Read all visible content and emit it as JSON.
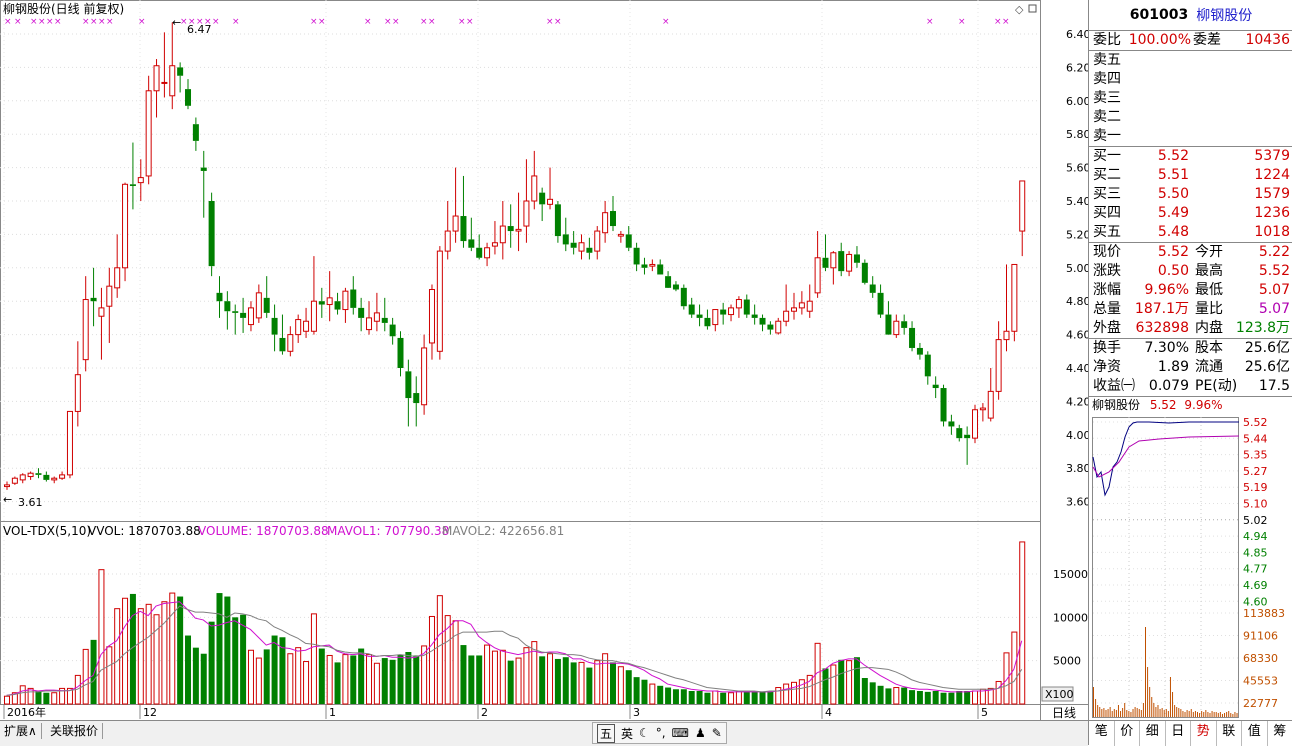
{
  "chart": {
    "title": "柳钢股份(日线 前复权)",
    "price_axis": [
      "6.40",
      "6.20",
      "6.00",
      "5.80",
      "5.60",
      "5.40",
      "5.20",
      "5.00",
      "4.80",
      "4.60",
      "4.40",
      "4.20",
      "4.00",
      "3.80",
      "3.60"
    ],
    "high_label": "6.47",
    "low_label": "3.61",
    "vol_header": {
      "name": "VOL-TDX(5,10)",
      "vvol": "VVOL: 1870703.88",
      "volume": "VOLUME: 1870703.88",
      "mavol1": "MAVOL1: 707790.38",
      "mavol2": "MAVOL2: 422656.81"
    },
    "vol_axis": [
      "15000",
      "10000",
      "5000"
    ],
    "vol_unit": "X100",
    "time_labels": [
      "2016年",
      "12",
      "1",
      "2",
      "3",
      "4",
      "5"
    ],
    "period_label": "日线",
    "colors": {
      "up": "#d00000",
      "down": "#008000",
      "ma1": "#d010d0",
      "ma2": "#808080"
    }
  },
  "quote": {
    "code": "601003",
    "name": "柳钢股份",
    "weibi_label": "委比",
    "weibi": "100.00%",
    "weicha_label": "委差",
    "weicha": "10436",
    "sells": [
      {
        "label": "卖五",
        "price": "",
        "vol": ""
      },
      {
        "label": "卖四",
        "price": "",
        "vol": ""
      },
      {
        "label": "卖三",
        "price": "",
        "vol": ""
      },
      {
        "label": "卖二",
        "price": "",
        "vol": ""
      },
      {
        "label": "卖一",
        "price": "",
        "vol": ""
      }
    ],
    "buys": [
      {
        "label": "买一",
        "price": "5.52",
        "vol": "5379"
      },
      {
        "label": "买二",
        "price": "5.51",
        "vol": "1224"
      },
      {
        "label": "买三",
        "price": "5.50",
        "vol": "1579"
      },
      {
        "label": "买四",
        "price": "5.49",
        "vol": "1236"
      },
      {
        "label": "买五",
        "price": "5.48",
        "vol": "1018"
      }
    ],
    "stats": [
      {
        "l1": "现价",
        "v1": "5.52",
        "c1": "red",
        "l2": "今开",
        "v2": "5.22",
        "c2": "red"
      },
      {
        "l1": "涨跌",
        "v1": "0.50",
        "c1": "red",
        "l2": "最高",
        "v2": "5.52",
        "c2": "red"
      },
      {
        "l1": "涨幅",
        "v1": "9.96%",
        "c1": "red",
        "l2": "最低",
        "v2": "5.07",
        "c2": "red"
      },
      {
        "l1": "总量",
        "v1": "187.1万",
        "c1": "dark-red",
        "l2": "量比",
        "v2": "5.07",
        "c2": "mag"
      },
      {
        "l1": "外盘",
        "v1": "632898",
        "c1": "red",
        "l2": "内盘",
        "v2": "123.8万",
        "c2": "green"
      }
    ],
    "stats2": [
      {
        "l1": "换手",
        "v1": "7.30%",
        "l2": "股本",
        "v2": "25.6亿"
      },
      {
        "l1": "净资",
        "v1": "1.89",
        "l2": "流通",
        "v2": "25.6亿"
      },
      {
        "l1": "收益㈠",
        "v1": "0.079",
        "l2": "PE(动)",
        "v2": "17.5"
      }
    ],
    "minute_header": {
      "name": "柳钢股份",
      "price": "5.52",
      "pct": "9.96%"
    },
    "minute_price_axis": [
      "5.52",
      "5.44",
      "5.35",
      "5.27",
      "5.19",
      "5.10",
      "5.02",
      "4.94",
      "4.85",
      "4.77",
      "4.69",
      "4.60"
    ],
    "minute_vol_axis": [
      "113883",
      "91106",
      "68330",
      "45553",
      "22777"
    ]
  },
  "bottom_tabs_left": [
    "扩展∧",
    "关联报价"
  ],
  "ime_bar": [
    "五",
    "英"
  ],
  "right_tabs": [
    {
      "label": "笔",
      "active": false
    },
    {
      "label": "价",
      "active": false
    },
    {
      "label": "细",
      "active": false
    },
    {
      "label": "日",
      "active": false
    },
    {
      "label": "势",
      "active": true
    },
    {
      "label": "联",
      "active": false
    },
    {
      "label": "值",
      "active": false
    },
    {
      "label": "筹",
      "active": false
    }
  ],
  "candles": [
    [
      3.69,
      3.72,
      3.67,
      3.7
    ],
    [
      3.71,
      3.75,
      3.7,
      3.74
    ],
    [
      3.73,
      3.77,
      3.71,
      3.76
    ],
    [
      3.75,
      3.78,
      3.73,
      3.77
    ],
    [
      3.77,
      3.8,
      3.74,
      3.76
    ],
    [
      3.76,
      3.78,
      3.72,
      3.73
    ],
    [
      3.73,
      3.75,
      3.71,
      3.74
    ],
    [
      3.74,
      3.78,
      3.73,
      3.76
    ],
    [
      3.76,
      4.14,
      3.74,
      4.14
    ],
    [
      4.14,
      4.56,
      4.05,
      4.36
    ],
    [
      4.45,
      4.95,
      4.38,
      4.81
    ],
    [
      4.82,
      5.0,
      4.65,
      4.8
    ],
    [
      4.71,
      4.88,
      4.45,
      4.76
    ],
    [
      4.77,
      5.0,
      4.55,
      4.89
    ],
    [
      4.88,
      5.2,
      4.82,
      5.0
    ],
    [
      5.0,
      5.51,
      4.92,
      5.5
    ],
    [
      5.5,
      5.75,
      5.35,
      5.49
    ],
    [
      5.51,
      5.65,
      5.4,
      5.54
    ],
    [
      5.55,
      6.15,
      5.5,
      6.06
    ],
    [
      6.06,
      6.25,
      5.9,
      6.21
    ],
    [
      6.11,
      6.41,
      6.02,
      6.11
    ],
    [
      6.03,
      6.47,
      5.95,
      6.21
    ],
    [
      6.2,
      6.23,
      6.05,
      6.15
    ],
    [
      6.07,
      6.13,
      5.95,
      5.97
    ],
    [
      5.86,
      5.9,
      5.7,
      5.76
    ],
    [
      5.6,
      5.7,
      5.3,
      5.58
    ],
    [
      5.4,
      5.45,
      4.95,
      5.01
    ],
    [
      4.85,
      4.95,
      4.7,
      4.8
    ],
    [
      4.8,
      4.86,
      4.63,
      4.74
    ],
    [
      4.74,
      4.78,
      4.6,
      4.73
    ],
    [
      4.73,
      4.82,
      4.61,
      4.7
    ],
    [
      4.66,
      4.8,
      4.62,
      4.76
    ],
    [
      4.7,
      4.9,
      4.67,
      4.85
    ],
    [
      4.82,
      4.95,
      4.7,
      4.73
    ],
    [
      4.7,
      4.78,
      4.5,
      4.6
    ],
    [
      4.58,
      4.72,
      4.48,
      4.5
    ],
    [
      4.5,
      4.65,
      4.47,
      4.6
    ],
    [
      4.6,
      4.72,
      4.55,
      4.69
    ],
    [
      4.62,
      4.76,
      4.58,
      4.68
    ],
    [
      4.62,
      5.07,
      4.6,
      4.8
    ],
    [
      4.8,
      4.88,
      4.7,
      4.78
    ],
    [
      4.78,
      4.98,
      4.68,
      4.82
    ],
    [
      4.8,
      4.85,
      4.72,
      4.75
    ],
    [
      4.75,
      4.88,
      4.67,
      4.86
    ],
    [
      4.87,
      4.95,
      4.72,
      4.76
    ],
    [
      4.76,
      4.82,
      4.62,
      4.7
    ],
    [
      4.63,
      4.8,
      4.6,
      4.7
    ],
    [
      4.68,
      4.85,
      4.62,
      4.73
    ],
    [
      4.7,
      4.82,
      4.62,
      4.67
    ],
    [
      4.66,
      4.7,
      4.54,
      4.59
    ],
    [
      4.58,
      4.62,
      4.35,
      4.4
    ],
    [
      4.38,
      4.45,
      4.05,
      4.22
    ],
    [
      4.25,
      4.35,
      4.05,
      4.19
    ],
    [
      4.18,
      4.6,
      4.12,
      4.52
    ],
    [
      4.55,
      4.9,
      4.45,
      4.87
    ],
    [
      4.5,
      5.13,
      4.45,
      5.1
    ],
    [
      5.1,
      5.4,
      5.05,
      5.22
    ],
    [
      5.22,
      5.6,
      5.15,
      5.31
    ],
    [
      5.31,
      5.55,
      5.12,
      5.16
    ],
    [
      5.17,
      5.3,
      5.1,
      5.12
    ],
    [
      5.12,
      5.2,
      5.05,
      5.06
    ],
    [
      5.06,
      5.15,
      5.01,
      5.12
    ],
    [
      5.13,
      5.28,
      5.08,
      5.15
    ],
    [
      5.15,
      5.4,
      5.05,
      5.25
    ],
    [
      5.25,
      5.38,
      5.12,
      5.22
    ],
    [
      5.22,
      5.45,
      5.1,
      5.23
    ],
    [
      5.25,
      5.65,
      5.15,
      5.4
    ],
    [
      5.4,
      5.7,
      5.35,
      5.55
    ],
    [
      5.45,
      5.48,
      5.28,
      5.38
    ],
    [
      5.38,
      5.6,
      5.35,
      5.41
    ],
    [
      5.38,
      5.4,
      5.15,
      5.19
    ],
    [
      5.2,
      5.3,
      5.1,
      5.14
    ],
    [
      5.15,
      5.22,
      5.08,
      5.12
    ],
    [
      5.1,
      5.2,
      5.05,
      5.15
    ],
    [
      5.12,
      5.18,
      5.05,
      5.09
    ],
    [
      5.1,
      5.25,
      5.05,
      5.22
    ],
    [
      5.21,
      5.4,
      5.15,
      5.33
    ],
    [
      5.34,
      5.43,
      5.22,
      5.25
    ],
    [
      5.19,
      5.22,
      5.15,
      5.2
    ],
    [
      5.2,
      5.25,
      5.1,
      5.12
    ],
    [
      5.12,
      5.15,
      4.98,
      5.02
    ],
    [
      5.02,
      5.06,
      4.96,
      5.0
    ],
    [
      5.01,
      5.05,
      4.98,
      5.02
    ],
    [
      5.02,
      5.05,
      4.98,
      4.96
    ],
    [
      4.95,
      4.98,
      4.9,
      4.88
    ],
    [
      4.9,
      4.92,
      4.86,
      4.87
    ],
    [
      4.88,
      4.9,
      4.75,
      4.77
    ],
    [
      4.78,
      4.82,
      4.7,
      4.72
    ],
    [
      4.72,
      4.78,
      4.65,
      4.7
    ],
    [
      4.7,
      4.75,
      4.63,
      4.65
    ],
    [
      4.66,
      4.72,
      4.62,
      4.75
    ],
    [
      4.75,
      4.79,
      4.66,
      4.72
    ],
    [
      4.72,
      4.78,
      4.68,
      4.76
    ],
    [
      4.76,
      4.83,
      4.7,
      4.81
    ],
    [
      4.81,
      4.84,
      4.7,
      4.72
    ],
    [
      4.72,
      4.78,
      4.66,
      4.7
    ],
    [
      4.7,
      4.72,
      4.62,
      4.66
    ],
    [
      4.66,
      4.68,
      4.6,
      4.63
    ],
    [
      4.61,
      4.7,
      4.6,
      4.68
    ],
    [
      4.68,
      4.9,
      4.65,
      4.74
    ],
    [
      4.74,
      4.85,
      4.69,
      4.76
    ],
    [
      4.76,
      4.86,
      4.72,
      4.79
    ],
    [
      4.74,
      4.9,
      4.7,
      4.8
    ],
    [
      4.85,
      5.22,
      4.82,
      5.06
    ],
    [
      5.06,
      5.2,
      4.98,
      5.0
    ],
    [
      5.0,
      5.1,
      4.9,
      5.09
    ],
    [
      5.1,
      5.15,
      4.95,
      4.98
    ],
    [
      4.98,
      5.1,
      4.95,
      5.08
    ],
    [
      5.08,
      5.13,
      5.0,
      5.03
    ],
    [
      5.03,
      5.05,
      4.9,
      4.91
    ],
    [
      4.9,
      4.95,
      4.82,
      4.85
    ],
    [
      4.85,
      4.9,
      4.7,
      4.72
    ],
    [
      4.72,
      4.8,
      4.65,
      4.6
    ],
    [
      4.6,
      4.72,
      4.58,
      4.68
    ],
    [
      4.68,
      4.72,
      4.6,
      4.64
    ],
    [
      4.64,
      4.68,
      4.5,
      4.52
    ],
    [
      4.52,
      4.55,
      4.45,
      4.48
    ],
    [
      4.48,
      4.5,
      4.3,
      4.35
    ],
    [
      4.3,
      4.35,
      4.22,
      4.28
    ],
    [
      4.28,
      4.3,
      4.05,
      4.08
    ],
    [
      4.08,
      4.12,
      4.0,
      4.05
    ],
    [
      4.04,
      4.06,
      3.96,
      3.98
    ],
    [
      4.0,
      4.05,
      3.82,
      3.98
    ],
    [
      3.98,
      4.18,
      3.95,
      4.15
    ],
    [
      4.15,
      4.19,
      4.08,
      4.16
    ],
    [
      4.1,
      4.4,
      4.08,
      4.26
    ],
    [
      4.26,
      4.68,
      4.21,
      4.57
    ],
    [
      4.57,
      5.02,
      4.5,
      4.62
    ],
    [
      4.62,
      5.02,
      4.56,
      5.02
    ],
    [
      5.22,
      5.52,
      5.07,
      5.52
    ]
  ],
  "volumes": [
    900,
    1300,
    2100,
    1800,
    1500,
    1300,
    1300,
    1800,
    1800,
    3300,
    6300,
    7400,
    15500,
    6600,
    11000,
    12200,
    12700,
    11000,
    11500,
    10300,
    11800,
    12800,
    12400,
    7900,
    6500,
    5800,
    9500,
    12800,
    12400,
    10000,
    10300,
    6200,
    5300,
    6300,
    7900,
    7700,
    5800,
    6500,
    4900,
    10400,
    6400,
    5600,
    4800,
    5700,
    5600,
    6400,
    5700,
    4700,
    5300,
    5100,
    5700,
    6000,
    5600,
    6700,
    10100,
    12500,
    10200,
    9600,
    6800,
    5600,
    5600,
    6800,
    6100,
    6200,
    5000,
    5300,
    6500,
    7200,
    5500,
    5800,
    5200,
    5400,
    4800,
    4800,
    4200,
    5000,
    5800,
    4800,
    4300,
    3900,
    3100,
    2800,
    2300,
    2100,
    1900,
    1700,
    1700,
    1500,
    1500,
    1300,
    1500,
    1300,
    1300,
    1500,
    1400,
    1500,
    1400,
    1400,
    1900,
    2300,
    2500,
    2800,
    3300,
    7000,
    4100,
    4500,
    5100,
    5000,
    5400,
    3000,
    2500,
    2100,
    1800,
    1900,
    1900,
    1600,
    1500,
    1400,
    1500,
    1300,
    1300,
    1500,
    1500,
    1500,
    1700,
    1800,
    2600,
    5900,
    8300,
    18700
  ],
  "ma1": [
    1000,
    1150,
    1500,
    1650,
    1500,
    1600,
    1600,
    1550,
    1550,
    1950,
    2700,
    3300,
    5700,
    6700,
    7300,
    8900,
    10200,
    10700,
    10200,
    11300,
    11600,
    11700,
    11800,
    10900,
    9900,
    9700,
    9000,
    9100,
    9400,
    9600,
    9100,
    8600,
    7700,
    6800,
    7100,
    6500,
    6400,
    6100,
    6200,
    6600,
    6700,
    6800,
    6100,
    5800,
    5700,
    5800,
    5500,
    5500,
    5600,
    5400,
    5400,
    5300,
    5400,
    5800,
    6800,
    8000,
    8700,
    9600,
    9600,
    9200,
    7800,
    7100,
    6500,
    6100,
    5900,
    5700,
    5900,
    6100,
    5900,
    6000,
    6000,
    5800,
    5200,
    5200,
    4800,
    4600,
    4700,
    4700,
    4700,
    4600,
    4300,
    3900,
    3300,
    2900,
    2300,
    2100,
    1900,
    1700,
    1600,
    1500,
    1500,
    1400,
    1400,
    1400,
    1400,
    1400,
    1400,
    1400,
    1500,
    1700,
    1900,
    2200,
    2600,
    3600,
    4000,
    4700,
    5000,
    5200,
    5200,
    4500,
    3900,
    3300,
    2800,
    2300,
    2000,
    1800,
    1700,
    1700,
    1600,
    1500,
    1400,
    1400,
    1400,
    1500,
    1500,
    1600,
    1800,
    2700,
    4000,
    7300
  ],
  "ma2": [
    1000,
    1100,
    1300,
    1400,
    1400,
    1500,
    1500,
    1500,
    1550,
    1700,
    2200,
    2600,
    3900,
    4400,
    4900,
    5800,
    6500,
    7100,
    7700,
    8500,
    9300,
    10300,
    11300,
    10900,
    10600,
    10600,
    10500,
    10400,
    10000,
    10500,
    10400,
    10200,
    9800,
    9600,
    8900,
    8500,
    8000,
    7600,
    7000,
    6900,
    6700,
    6600,
    6200,
    6000,
    5900,
    5900,
    5800,
    5500,
    5600,
    5600,
    5700,
    5600,
    5500,
    5600,
    6100,
    6700,
    7200,
    7900,
    8300,
    8300,
    8300,
    8300,
    8400,
    8400,
    7900,
    7600,
    6800,
    6300,
    6000,
    5900,
    5800,
    5700,
    5700,
    5600,
    5300,
    5100,
    5000,
    5000,
    4800,
    4700,
    4400,
    4200,
    3900,
    3600,
    3300,
    3000,
    2800,
    2500,
    2200,
    1900,
    1800,
    1700,
    1600,
    1500,
    1500,
    1500,
    1400,
    1500,
    1500,
    1600,
    1700,
    1800,
    2000,
    2400,
    2800,
    3100,
    3500,
    3800,
    4100,
    4200,
    4200,
    4100,
    4000,
    3700,
    3300,
    2800,
    2500,
    2300,
    2100,
    1900,
    1800,
    1700,
    1700,
    1700,
    1700,
    1700,
    1800,
    2100,
    2600,
    4000
  ]
}
